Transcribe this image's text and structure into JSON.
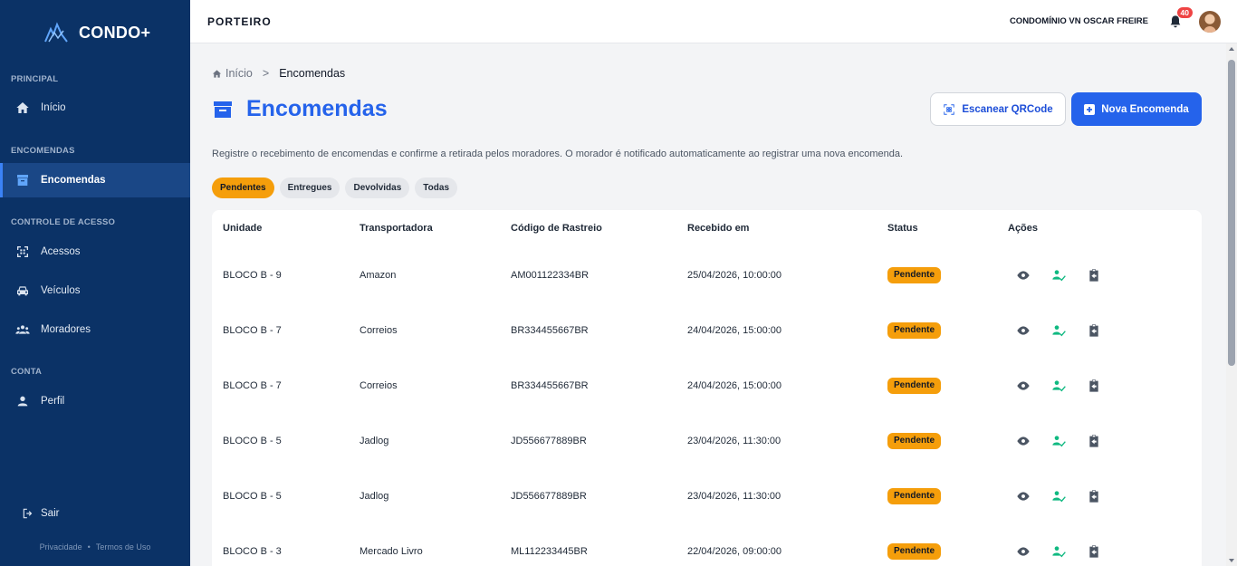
{
  "sidebar": {
    "brand": "CONDO+",
    "sections": {
      "principal": "PRINCIPAL",
      "encomendas": "ENCOMENDAS",
      "controle": "CONTROLE DE ACESSO",
      "conta": "CONTA"
    },
    "items": {
      "inicio": "Início",
      "encomendas": "Encomendas",
      "acessos": "Acessos",
      "veiculos": "Veículos",
      "moradores": "Moradores",
      "perfil": "Perfil"
    },
    "logout": "Sair",
    "footer": {
      "privacy": "Privacidade",
      "terms": "Termos de Uso"
    },
    "accent_color": "#0b3266"
  },
  "topbar": {
    "role": "PORTEIRO",
    "condominium": "CONDOMÍNIO VN OSCAR FREIRE",
    "notification_count": "40"
  },
  "breadcrumb": {
    "home": "Início",
    "separator": ">",
    "current": "Encomendas"
  },
  "page": {
    "title": "Encomendas",
    "description": "Registre o recebimento de encomendas e confirme a retirada pelos moradores. O morador é notificado automaticamente ao registrar uma nova encomenda.",
    "btn_scan": "Escanear QRCode",
    "btn_new": "Nova Encomenda",
    "primary_color": "#2563eb",
    "pending_color": "#f59e0b"
  },
  "filters": {
    "pendentes": "Pendentes",
    "entregues": "Entregues",
    "devolvidas": "Devolvidas",
    "todas": "Todas",
    "selected": "Pendentes"
  },
  "table": {
    "headers": {
      "unidade": "Unidade",
      "transportadora": "Transportadora",
      "codigo": "Código de Rastreio",
      "recebido": "Recebido em",
      "status": "Status",
      "acoes": "Ações"
    },
    "rows": [
      {
        "unidade": "BLOCO B - 9",
        "transportadora": "Amazon",
        "codigo": "AM001122334BR",
        "recebido": "25/04/2026, 10:00:00",
        "status": "Pendente"
      },
      {
        "unidade": "BLOCO B - 7",
        "transportadora": "Correios",
        "codigo": "BR334455667BR",
        "recebido": "24/04/2026, 15:00:00",
        "status": "Pendente"
      },
      {
        "unidade": "BLOCO B - 7",
        "transportadora": "Correios",
        "codigo": "BR334455667BR",
        "recebido": "24/04/2026, 15:00:00",
        "status": "Pendente"
      },
      {
        "unidade": "BLOCO B - 5",
        "transportadora": "Jadlog",
        "codigo": "JD556677889BR",
        "recebido": "23/04/2026, 11:30:00",
        "status": "Pendente"
      },
      {
        "unidade": "BLOCO B - 5",
        "transportadora": "Jadlog",
        "codigo": "JD556677889BR",
        "recebido": "23/04/2026, 11:30:00",
        "status": "Pendente"
      },
      {
        "unidade": "BLOCO B - 3",
        "transportadora": "Mercado Livro",
        "codigo": "ML112233445BR",
        "recebido": "22/04/2026, 09:00:00",
        "status": "Pendente"
      }
    ],
    "row_actions": [
      "eye-icon",
      "user-check-icon",
      "return-box-icon"
    ]
  }
}
